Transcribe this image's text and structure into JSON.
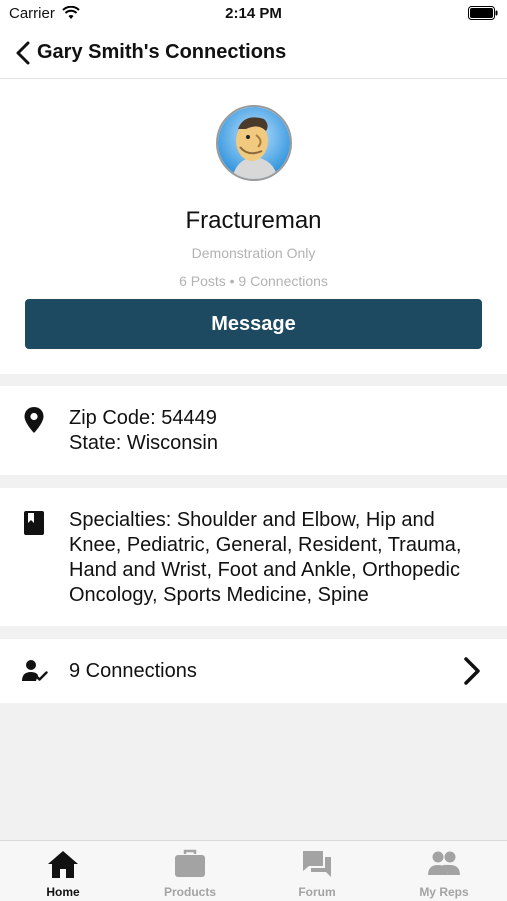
{
  "status_bar": {
    "carrier": "Carrier",
    "time": "2:14 PM"
  },
  "nav": {
    "title": "Gary Smith's Connections"
  },
  "profile": {
    "name": "Fractureman",
    "subtitle": "Demonstration Only",
    "stats": "6 Posts • 9 Connections",
    "message_label": "Message"
  },
  "location": {
    "zip": "Zip Code: 54449",
    "state": "State: Wisconsin"
  },
  "specialties": {
    "text": "Specialties: Shoulder and Elbow, Hip and Knee, Pediatric, General, Resident, Trauma, Hand and Wrist, Foot and Ankle, Orthopedic Oncology, Sports Medicine, Spine"
  },
  "connections": {
    "label": "9 Connections"
  },
  "tabs": [
    {
      "label": "Home",
      "icon": "home-icon",
      "active": true
    },
    {
      "label": "Products",
      "icon": "briefcase-icon",
      "active": false
    },
    {
      "label": "Forum",
      "icon": "forum-icon",
      "active": false
    },
    {
      "label": "My Reps",
      "icon": "people-icon",
      "active": false
    }
  ],
  "colors": {
    "accent": "#1d4a61",
    "background": "#f1f1f1",
    "muted_text": "#b2b2b2",
    "tab_inactive": "#a3a3a3"
  }
}
